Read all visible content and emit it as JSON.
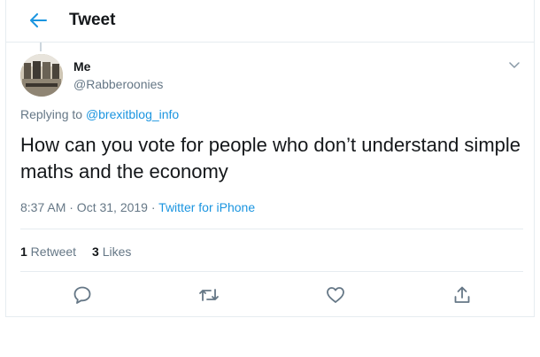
{
  "header": {
    "title": "Tweet"
  },
  "author": {
    "name": "Me",
    "handle": "@Rabberoonies"
  },
  "replying": {
    "prefix": "Replying to ",
    "mention": "@brexitblog_info"
  },
  "tweet": {
    "text": "How can you vote for people who don’t understand simple maths and the economy",
    "timestamp": "8:37 AM · Oct 31, 2019 · ",
    "source": "Twitter for iPhone"
  },
  "stats": {
    "retweets_count": "1",
    "retweets_label": " Retweet",
    "likes_count": "3",
    "likes_label": " Likes"
  },
  "icons": {
    "back": "arrow-left-icon",
    "caret": "chevron-down-icon",
    "reply": "comment-icon",
    "retweet": "retweet-icon",
    "like": "heart-icon",
    "share": "share-icon"
  },
  "colors": {
    "accent": "#1b95e0",
    "secondary_text": "#657786",
    "icon": "#657786"
  }
}
